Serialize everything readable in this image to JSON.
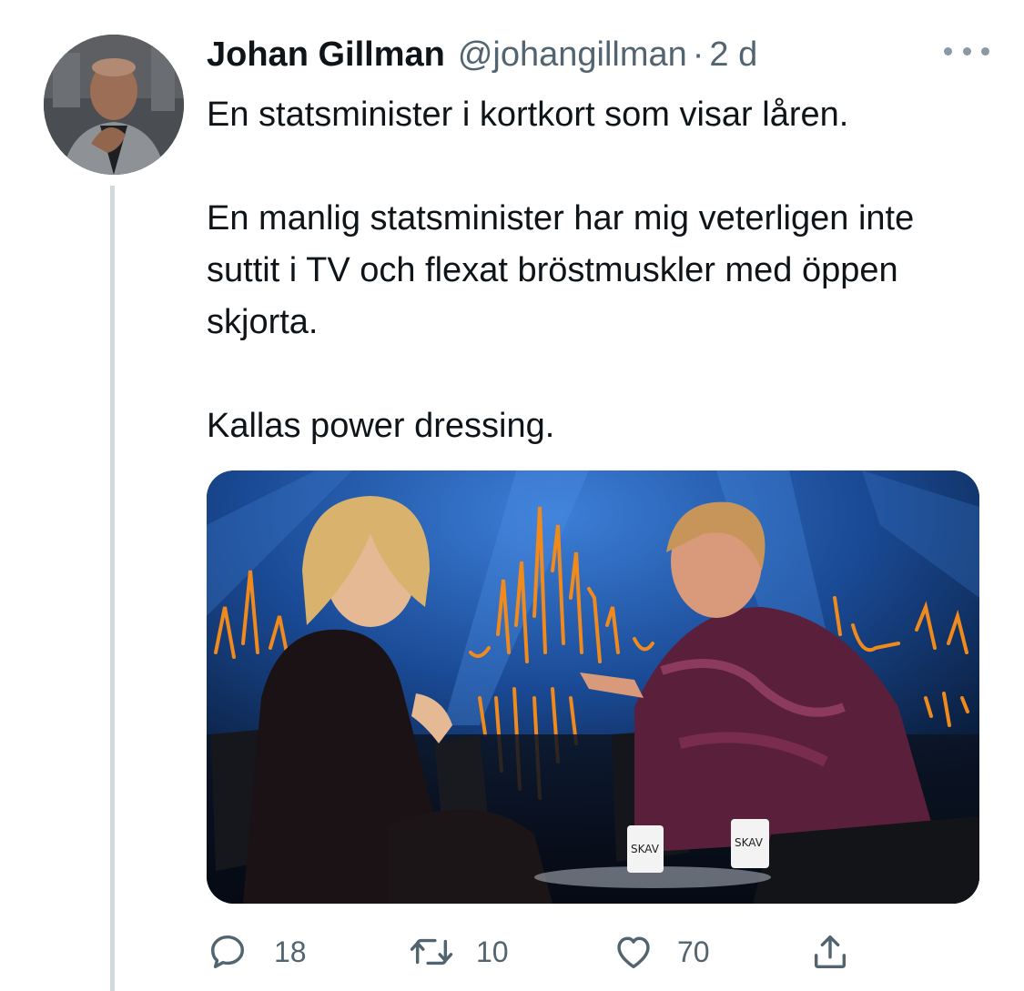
{
  "tweet": {
    "author_name": "Johan Gillman",
    "handle": "@johangillman",
    "separator": "·",
    "time": "2 d",
    "paragraphs": [
      "En statsminister i kortkort som visar låren.",
      "En manlig statsminister har mig veterligen inte suttit i TV och flexat bröstmuskler med öppen skjorta.",
      "Kallas power dressing."
    ],
    "mug_logo": "SKAV"
  },
  "actions": {
    "replies": "18",
    "retweets": "10",
    "likes": "70"
  },
  "icons": {
    "more": "more-dots-icon",
    "reply": "reply-bubble-icon",
    "retweet": "retweet-icon",
    "like": "heart-icon",
    "share": "share-upload-icon"
  },
  "colors": {
    "text": "#0f1419",
    "secondary": "#536471",
    "thread_line": "#cfd9de",
    "stage_blue": "#1c4f9c",
    "stage_orange": "#f08a1c"
  }
}
